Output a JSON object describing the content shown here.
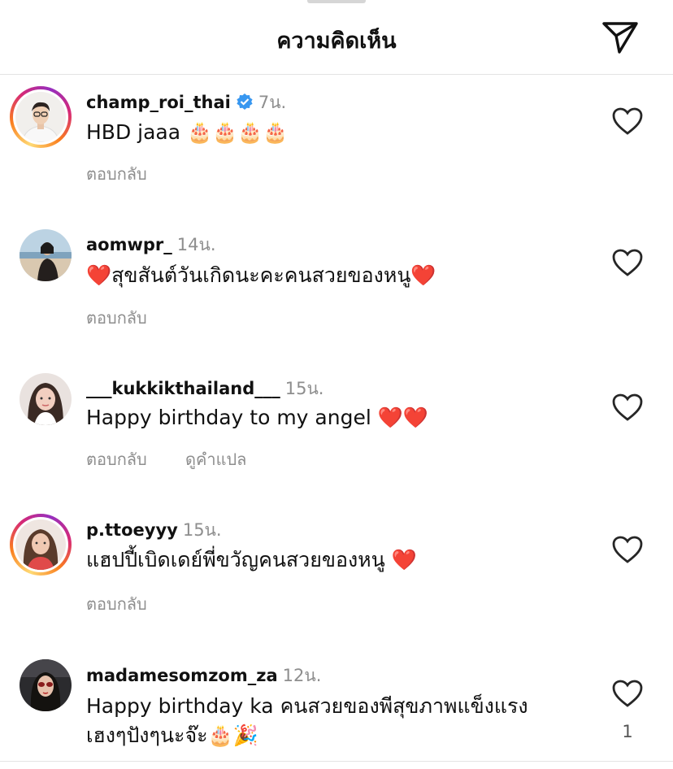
{
  "header": {
    "title": "ความคิดเห็น",
    "share_icon": "paper-plane-icon"
  },
  "comments": [
    {
      "username": "champ_roi_thai",
      "verified": true,
      "time": "7น.",
      "text": "HBD jaaa 🎂🎂🎂🎂",
      "reply": "ตอบกลับ",
      "ring": true
    },
    {
      "username": "aomwpr_",
      "time": "14น.",
      "text": "❤️สุขสันต์วันเกิดนะคะคนสวยของหนู❤️",
      "reply": "ตอบกลับ",
      "ring": false
    },
    {
      "username": "___kukkikthailand___",
      "time": "15น.",
      "text": "Happy birthday to my angel ❤️❤️",
      "reply": "ตอบกลับ",
      "translate": "ดูคำแปล",
      "ring": false
    },
    {
      "username": "p.ttoeyyy",
      "time": "15น.",
      "text": "แฮปปี้เบิดเดย์พี่ขวัญคนสวยของหนู ❤️",
      "reply": "ตอบกลับ",
      "ring": true
    },
    {
      "username": "madamesomzom_za",
      "time": "12น.",
      "text_line1": "Happy birthday ka คนสวยของพีสุขภาพแข็งแรง",
      "text_line2": "เฮงๆปังๆนะจ๊ะ🎂🎉",
      "likes": "1",
      "ring": false
    }
  ],
  "colors": {
    "verified": "#3897f0",
    "ring_start": "#feda75",
    "ring_end": "#962fbf",
    "muted": "#8e8e8e"
  }
}
